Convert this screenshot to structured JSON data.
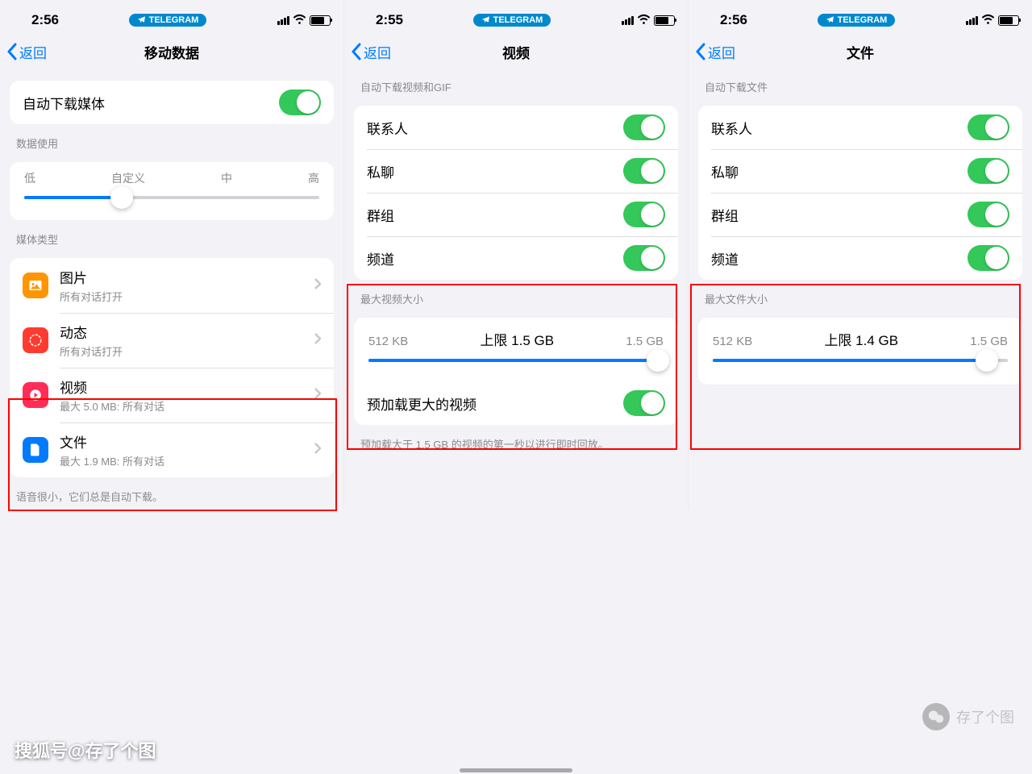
{
  "screens": {
    "s1": {
      "time": "2:56",
      "pill": "TELEGRAM",
      "back": "返回",
      "title": "移动数据",
      "autoDownload": "自动下载媒体",
      "dataUsage": "数据使用",
      "sliderTicks": {
        "low": "低",
        "custom": "自定义",
        "mid": "中",
        "high": "高"
      },
      "mediaHeader": "媒体类型",
      "media": {
        "photo": {
          "title": "图片",
          "sub": "所有对话打开"
        },
        "anim": {
          "title": "动态",
          "sub": "所有对话打开"
        },
        "video": {
          "title": "视频",
          "sub": "最大 5.0 MB: 所有对话"
        },
        "file": {
          "title": "文件",
          "sub": "最大 1.9 MB: 所有对话"
        }
      },
      "footer": "语音很小，它们总是自动下载。"
    },
    "s2": {
      "time": "2:55",
      "pill": "TELEGRAM",
      "back": "返回",
      "title": "视频",
      "header1": "自动下载视频和GIF",
      "rows": {
        "contacts": "联系人",
        "private": "私聊",
        "groups": "群组",
        "channels": "频道"
      },
      "maxHeader": "最大视频大小",
      "min": "512 KB",
      "limit": "上限 1.5 GB",
      "max": "1.5 GB",
      "preload": "预加载更大的视频",
      "preloadFooter": "预加载大于 1.5 GB 的视频的第一秒以进行即时回放。"
    },
    "s3": {
      "time": "2:56",
      "pill": "TELEGRAM",
      "back": "返回",
      "title": "文件",
      "header1": "自动下载文件",
      "rows": {
        "contacts": "联系人",
        "private": "私聊",
        "groups": "群组",
        "channels": "频道"
      },
      "maxHeader": "最大文件大小",
      "min": "512 KB",
      "limit": "上限 1.4 GB",
      "max": "1.5 GB"
    }
  },
  "watermarks": {
    "bl": "搜狐号@存了个图",
    "br": "存了个图"
  }
}
